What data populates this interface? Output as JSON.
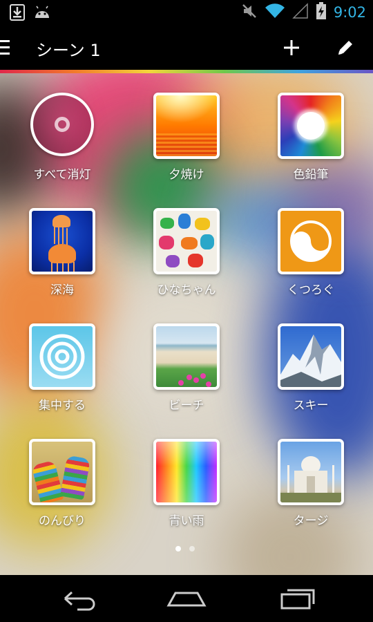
{
  "status_bar": {
    "time": "9:02",
    "icons": [
      "download-icon",
      "android-icon",
      "mute-icon",
      "wifi-icon",
      "signal-icon",
      "battery-charging-icon"
    ],
    "time_color": "#33b5e5"
  },
  "action_bar": {
    "title": "シーン 1",
    "icons": [
      "menu-icon",
      "add-icon",
      "edit-icon"
    ]
  },
  "scenes": [
    {
      "label": "すべて消灯",
      "icon": "power-off-icon"
    },
    {
      "label": "夕焼け",
      "icon": "sunset-photo"
    },
    {
      "label": "色鉛筆",
      "icon": "colored-pencils-photo"
    },
    {
      "label": "深海",
      "icon": "jellyfish-photo"
    },
    {
      "label": "ひなちゃん",
      "icon": "handprints-photo"
    },
    {
      "label": "くつろぐ",
      "icon": "relax-icon"
    },
    {
      "label": "集中する",
      "icon": "concentrate-icon"
    },
    {
      "label": "ビーチ",
      "icon": "beach-photo"
    },
    {
      "label": "スキー",
      "icon": "mountain-photo"
    },
    {
      "label": "のんびり",
      "icon": "socks-photo"
    },
    {
      "label": "青い雨",
      "icon": "rainbow-gradient"
    },
    {
      "label": "タージ",
      "icon": "taj-mahal-photo"
    }
  ],
  "pager": {
    "pages": 2,
    "current": 1
  },
  "nav_bar": {
    "icons": [
      "back-icon",
      "home-icon",
      "recent-apps-icon"
    ]
  }
}
